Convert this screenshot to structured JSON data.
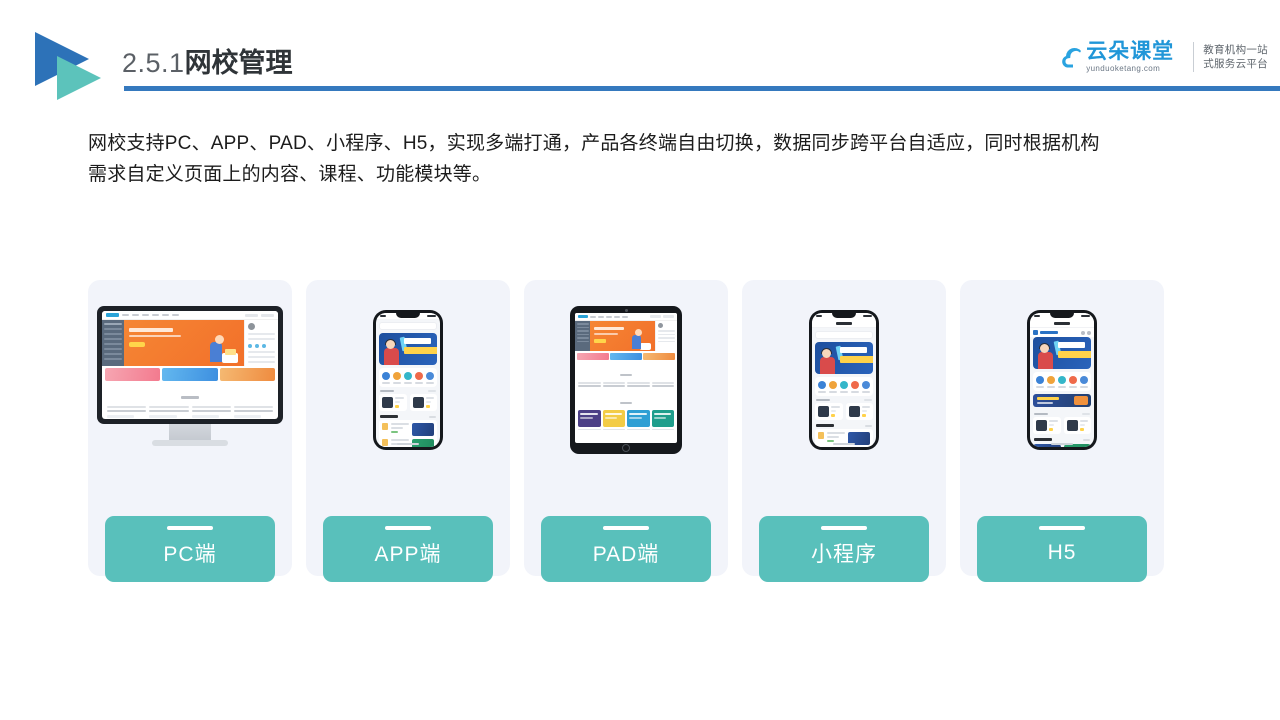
{
  "header": {
    "title_number": "2.5.1",
    "title_name": "网校管理",
    "logo_icon": "double-triangle-play-icon",
    "rule_color": "#3579be"
  },
  "brand": {
    "cloud_icon": "cloud-icon",
    "name_cn": "云朵课堂",
    "name_en": "yunduoketang.com",
    "tagline_line1": "教育机构一站",
    "tagline_line2": "式服务云平台",
    "accent_color": "#2096d8"
  },
  "intro": {
    "line1": "网校支持PC、APP、PAD、小程序、H5，实现多端打通，产品各终端自由切换，数据同步跨平台自适应，同时根据机构",
    "line2": "需求自定义页面上的内容、课程、功能模块等。"
  },
  "cards": [
    {
      "key": "pc",
      "label": "PC端",
      "device": "desktop-monitor-mockup"
    },
    {
      "key": "app",
      "label": "APP端",
      "device": "smartphone-mockup"
    },
    {
      "key": "pad",
      "label": "PAD端",
      "device": "tablet-mockup"
    },
    {
      "key": "miniapp",
      "label": "小程序",
      "device": "smartphone-mockup"
    },
    {
      "key": "h5",
      "label": "H5",
      "device": "smartphone-mockup"
    }
  ],
  "colors": {
    "label_teal": "#59c0bb",
    "card_background": "#f2f4fa",
    "title_dark": "#2f3438",
    "title_gray": "#5b6066",
    "rule_blue": "#3579be",
    "logo_blue": "#2d72b8",
    "logo_teal": "#5cc3bb",
    "page_background": "#ffffff"
  }
}
